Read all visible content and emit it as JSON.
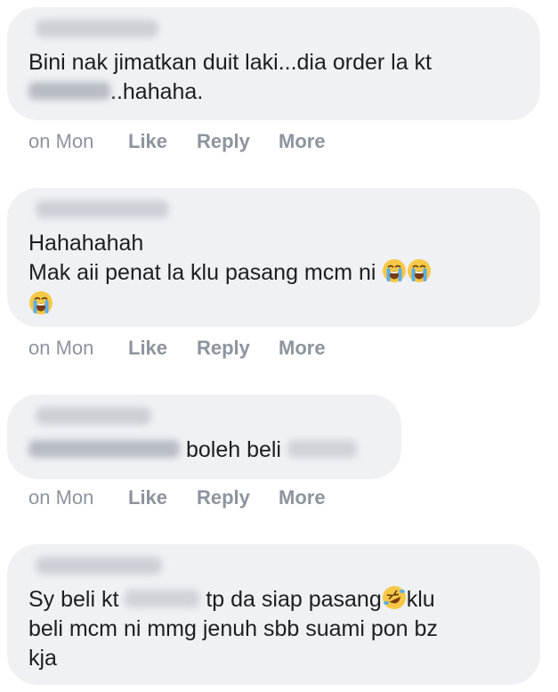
{
  "comments": [
    {
      "line1": "Bini nak jimatkan duit laki...dia order la kt",
      "line2_after_blur": "..hahaha."
    },
    {
      "line1": "Hahahahah",
      "line2": "Mak aii penat la klu pasang mcm ni"
    },
    {
      "text_mid": "boleh beli"
    },
    {
      "prefix": "Sy beli kt",
      "mid": "tp da siap pasang",
      "suffix": "klu",
      "line2": "beli mcm ni mmg jenuh sbb suami pon bz",
      "line3": "kja"
    }
  ],
  "actions": {
    "time": "on Mon",
    "like": "Like",
    "reply": "Reply",
    "more": "More"
  },
  "icons": {
    "crying": "loudly-crying-face-icon",
    "laughing": "rolling-on-floor-laughing-icon"
  },
  "colors": {
    "bubble": "#eff1f4",
    "text": "#1c1e21",
    "meta": "#8d949e",
    "emoji_yellow": "#f7c847"
  }
}
